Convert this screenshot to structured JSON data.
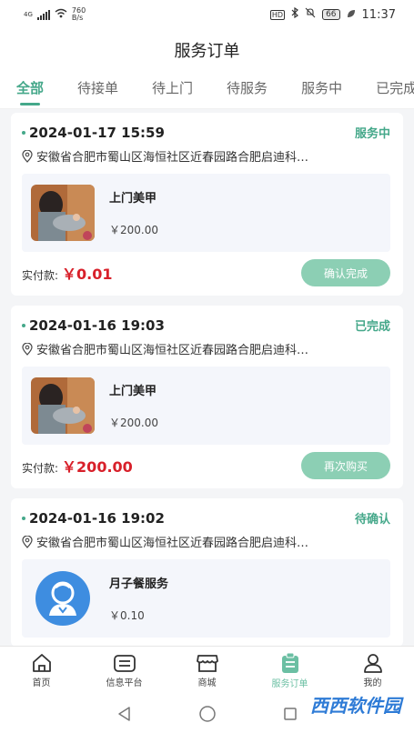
{
  "status_bar": {
    "network": "4G",
    "speed": "760",
    "speed_unit": "B/s",
    "hd": "HD",
    "battery": "66",
    "time": "11:37"
  },
  "header": {
    "title": "服务订单"
  },
  "tabs": [
    {
      "label": "全部",
      "active": true
    },
    {
      "label": "待接单"
    },
    {
      "label": "待上门"
    },
    {
      "label": "待服务"
    },
    {
      "label": "服务中"
    },
    {
      "label": "已完成"
    }
  ],
  "orders": [
    {
      "datetime": "2024-01-17 15:59",
      "status": "服务中",
      "address": "安徽省合肥市蜀山区海恒社区近春园路合肥启迪科…",
      "item_name": "上门美甲",
      "item_price": "￥200.00",
      "paid_label": "实付款:",
      "paid_amount": "￥0.01",
      "button": "确认完成",
      "thumb": "nail-photo"
    },
    {
      "datetime": "2024-01-16 19:03",
      "status": "已完成",
      "address": "安徽省合肥市蜀山区海恒社区近春园路合肥启迪科…",
      "item_name": "上门美甲",
      "item_price": "￥200.00",
      "paid_label": "实付款:",
      "paid_amount": "￥200.00",
      "button": "再次购买",
      "thumb": "nail-photo"
    },
    {
      "datetime": "2024-01-16 19:02",
      "status": "待确认",
      "address": "安徽省合肥市蜀山区海恒社区近春园路合肥启迪科…",
      "item_name": "月子餐服务",
      "item_price": "￥0.10",
      "thumb": "nurse-avatar-icon"
    }
  ],
  "bottom_nav": [
    {
      "label": "首页",
      "icon": "home-icon"
    },
    {
      "label": "信息平台",
      "icon": "message-box-icon"
    },
    {
      "label": "商城",
      "icon": "store-icon"
    },
    {
      "label": "服务订单",
      "icon": "clipboard-icon",
      "active": true
    },
    {
      "label": "我的",
      "icon": "person-icon"
    }
  ],
  "watermark": "西西软件园",
  "colors": {
    "accent": "#45a88a",
    "price": "#d8202a",
    "button": "#8ccfb4"
  }
}
